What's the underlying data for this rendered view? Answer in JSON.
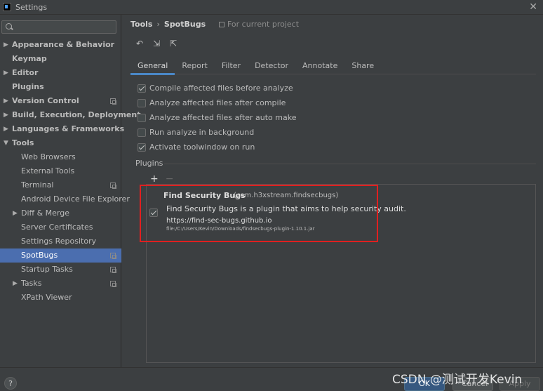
{
  "window": {
    "title": "Settings"
  },
  "search": {
    "placeholder": "",
    "value": ""
  },
  "sidebar": {
    "items": [
      {
        "label": "Appearance & Behavior",
        "bold": true,
        "arrow": "▶",
        "indent": 0,
        "project": false,
        "selected": false
      },
      {
        "label": "Keymap",
        "bold": true,
        "arrow": "",
        "indent": 0,
        "project": false,
        "selected": false
      },
      {
        "label": "Editor",
        "bold": true,
        "arrow": "▶",
        "indent": 0,
        "project": false,
        "selected": false
      },
      {
        "label": "Plugins",
        "bold": true,
        "arrow": "",
        "indent": 0,
        "project": false,
        "selected": false
      },
      {
        "label": "Version Control",
        "bold": true,
        "arrow": "▶",
        "indent": 0,
        "project": true,
        "selected": false
      },
      {
        "label": "Build, Execution, Deployment",
        "bold": true,
        "arrow": "▶",
        "indent": 0,
        "project": false,
        "selected": false
      },
      {
        "label": "Languages & Frameworks",
        "bold": true,
        "arrow": "▶",
        "indent": 0,
        "project": false,
        "selected": false
      },
      {
        "label": "Tools",
        "bold": true,
        "arrow": "▼",
        "indent": 0,
        "project": false,
        "selected": false
      },
      {
        "label": "Web Browsers",
        "bold": false,
        "arrow": "",
        "indent": 1,
        "project": false,
        "selected": false
      },
      {
        "label": "External Tools",
        "bold": false,
        "arrow": "",
        "indent": 1,
        "project": false,
        "selected": false
      },
      {
        "label": "Terminal",
        "bold": false,
        "arrow": "",
        "indent": 1,
        "project": true,
        "selected": false
      },
      {
        "label": "Android Device File Explorer",
        "bold": false,
        "arrow": "",
        "indent": 1,
        "project": false,
        "selected": false
      },
      {
        "label": "Diff & Merge",
        "bold": false,
        "arrow": "▶",
        "indent": 1,
        "project": false,
        "selected": false
      },
      {
        "label": "Server Certificates",
        "bold": false,
        "arrow": "",
        "indent": 1,
        "project": false,
        "selected": false
      },
      {
        "label": "Settings Repository",
        "bold": false,
        "arrow": "",
        "indent": 1,
        "project": false,
        "selected": false
      },
      {
        "label": "SpotBugs",
        "bold": false,
        "arrow": "",
        "indent": 1,
        "project": true,
        "selected": true
      },
      {
        "label": "Startup Tasks",
        "bold": false,
        "arrow": "",
        "indent": 1,
        "project": true,
        "selected": false
      },
      {
        "label": "Tasks",
        "bold": false,
        "arrow": "▶",
        "indent": 1,
        "project": true,
        "selected": false
      },
      {
        "label": "XPath Viewer",
        "bold": false,
        "arrow": "",
        "indent": 1,
        "project": false,
        "selected": false
      }
    ]
  },
  "breadcrumb": {
    "parent": "Tools",
    "separator": "›",
    "current": "SpotBugs",
    "scope": "For current project"
  },
  "toolbar": {
    "undo_icon": "↶",
    "import_icon": "⇲",
    "export_icon": "⇱"
  },
  "tabs": [
    {
      "label": "General",
      "active": true
    },
    {
      "label": "Report",
      "active": false
    },
    {
      "label": "Filter",
      "active": false
    },
    {
      "label": "Detector",
      "active": false
    },
    {
      "label": "Annotate",
      "active": false
    },
    {
      "label": "Share",
      "active": false
    }
  ],
  "options": [
    {
      "label": "Compile affected files before analyze",
      "checked": true
    },
    {
      "label": "Analyze affected files after compile",
      "checked": false
    },
    {
      "label": "Analyze affected files after auto make",
      "checked": false
    },
    {
      "label": "Run analyze in background",
      "checked": false
    },
    {
      "label": "Activate toolwindow on run",
      "checked": true
    }
  ],
  "plugins": {
    "section_label": "Plugins",
    "add": "+",
    "remove": "−",
    "item": {
      "name": "Find Security Bugs",
      "id": "(com.h3xstream.findsecbugs)",
      "description": "Find Security Bugs is a plugin that aims to help security audit.",
      "url": "https://find-sec-bugs.github.io",
      "file": "file:/C:/Users/Kevin/Downloads/findsecbugs-plugin-1.10.1.jar",
      "checked": true
    }
  },
  "buttons": {
    "help": "?",
    "ok": "OK",
    "cancel": "Cancel",
    "apply": "Apply"
  },
  "watermark": "CSDN @测试开发Kevin",
  "colors": {
    "selection": "#4b6eaf",
    "accent_tab": "#4a88c7",
    "highlight_box": "#e02020"
  }
}
